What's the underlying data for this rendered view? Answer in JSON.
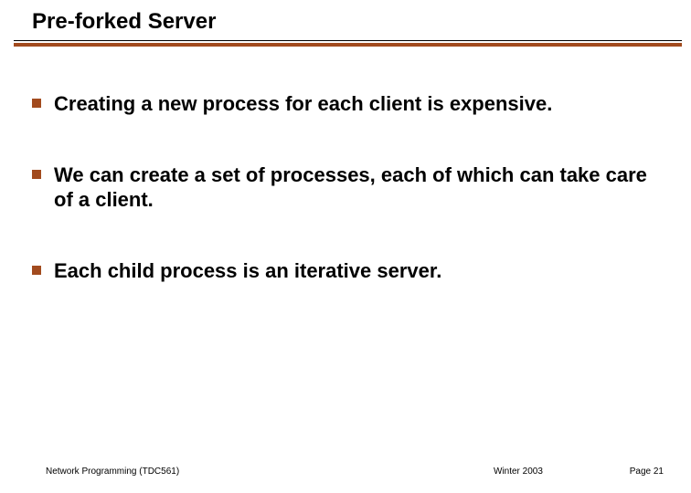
{
  "title": "Pre-forked Server",
  "bullets": [
    "Creating a new process for each client is expensive.",
    "We can create a set of processes, each of which can take care of a client.",
    "Each child process is an iterative server."
  ],
  "footer": {
    "left": "Network Programming (TDC561)",
    "center": "Winter  2003",
    "right": "Page 21"
  }
}
